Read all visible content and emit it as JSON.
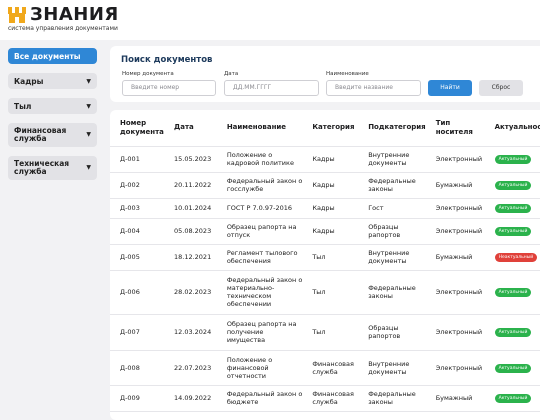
{
  "app": {
    "title": "ЗНАНИЯ",
    "subtitle": "система управления документами"
  },
  "sidebar": {
    "items": [
      {
        "label": "Все документы",
        "active": true,
        "dropdown": false
      },
      {
        "label": "Кадры",
        "active": false,
        "dropdown": true
      },
      {
        "label": "Тыл",
        "active": false,
        "dropdown": true
      },
      {
        "label": "Финансовая служба",
        "active": false,
        "dropdown": true
      },
      {
        "label": "Техническая служба",
        "active": false,
        "dropdown": true
      }
    ],
    "caret": "▼"
  },
  "search": {
    "title": "Поиск документов",
    "number_label": "Номер документа",
    "number_placeholder": "Введите номер",
    "date_label": "Дата",
    "date_placeholder": "ДД.ММ.ГГГГ",
    "name_label": "Наименование",
    "name_placeholder": "Введите название",
    "find_label": "Найти",
    "reset_label": "Сброс"
  },
  "table": {
    "headers": [
      "Номер документа",
      "Дата",
      "Наименование",
      "Категория",
      "Подкатегория",
      "Тип носителя",
      "Актуальность"
    ],
    "rows": [
      {
        "num": "Д-001",
        "date": "15.05.2023",
        "name": "Положение о кадровой политике",
        "cat": "Кадры",
        "sub": "Внутренние документы",
        "type": "Электронный",
        "status": "Актуальный"
      },
      {
        "num": "Д-002",
        "date": "20.11.2022",
        "name": "Федеральный закон о госслужбе",
        "cat": "Кадры",
        "sub": "Федеральные законы",
        "type": "Бумажный",
        "status": "Актуальный"
      },
      {
        "num": "Д-003",
        "date": "10.01.2024",
        "name": "ГОСТ Р 7.0.97-2016",
        "cat": "Кадры",
        "sub": "Гост",
        "type": "Электронный",
        "status": "Актуальный"
      },
      {
        "num": "Д-004",
        "date": "05.08.2023",
        "name": "Образец рапорта на отпуск",
        "cat": "Кадры",
        "sub": "Образцы рапортов",
        "type": "Электронный",
        "status": "Актуальный"
      },
      {
        "num": "Д-005",
        "date": "18.12.2021",
        "name": "Регламент тылового обеспечения",
        "cat": "Тыл",
        "sub": "Внутренние документы",
        "type": "Бумажный",
        "status": "Неактуальный"
      },
      {
        "num": "Д-006",
        "date": "28.02.2023",
        "name": "Федеральный закон о материально-техническом обеспечении",
        "cat": "Тыл",
        "sub": "Федеральные законы",
        "type": "Электронный",
        "status": "Актуальный"
      },
      {
        "num": "Д-007",
        "date": "12.03.2024",
        "name": "Образец рапорта на получение имущества",
        "cat": "Тыл",
        "sub": "Образцы рапортов",
        "type": "Электронный",
        "status": "Актуальный"
      },
      {
        "num": "Д-008",
        "date": "22.07.2023",
        "name": "Положение о финансовой отчетности",
        "cat": "Финансовая служба",
        "sub": "Внутренние документы",
        "type": "Электронный",
        "status": "Актуальный"
      },
      {
        "num": "Д-009",
        "date": "14.09.2022",
        "name": "Федеральный закон о бюджете",
        "cat": "Финансовая служба",
        "sub": "Федеральные законы",
        "type": "Бумажный",
        "status": "Актуальный"
      }
    ]
  },
  "colors": {
    "accent": "#2f87d6",
    "status_actual": "#2bb24c",
    "status_inactual": "#e0413a",
    "logo": "#f0a81c"
  }
}
